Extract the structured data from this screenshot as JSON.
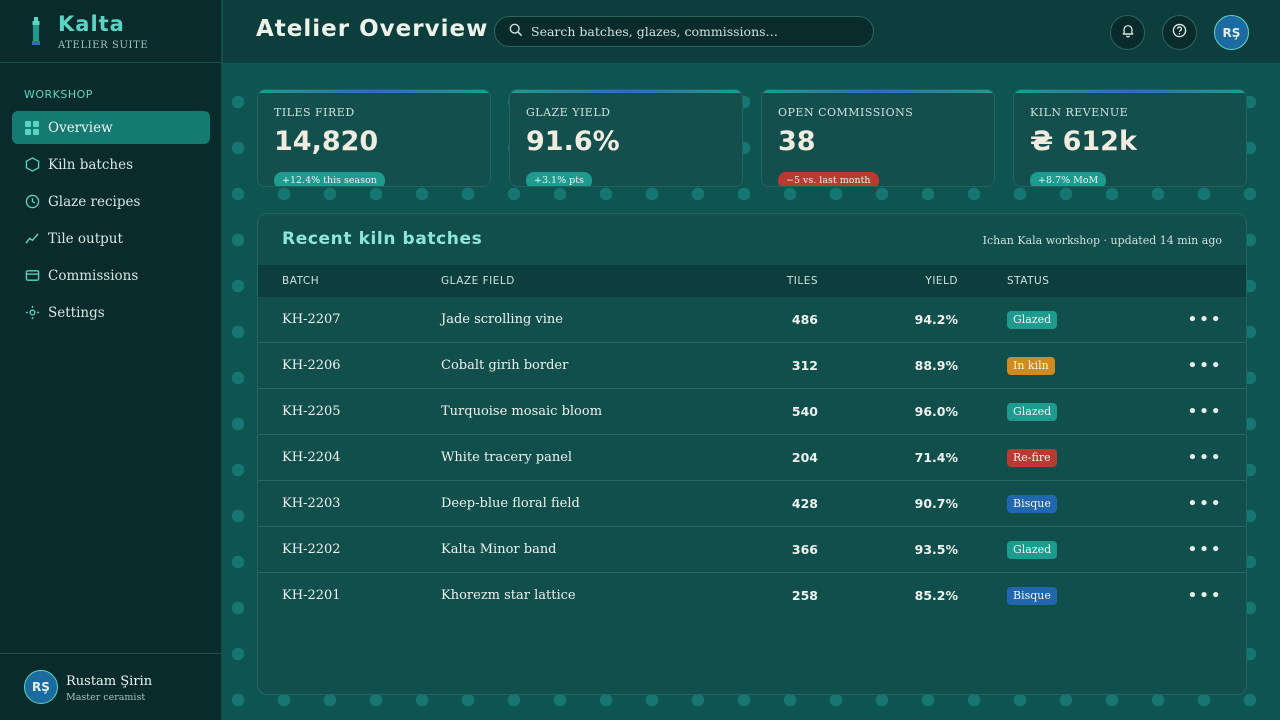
{
  "brand": {
    "name": "Kalta",
    "sub": "ATELIER SUITE"
  },
  "nav": {
    "section": "WORKSHOP",
    "items": [
      {
        "label": "Overview",
        "icon": "grid-icon"
      },
      {
        "label": "Kiln batches",
        "icon": "hexagon-icon"
      },
      {
        "label": "Glaze recipes",
        "icon": "clock-icon"
      },
      {
        "label": "Tile output",
        "icon": "chart-line-icon"
      },
      {
        "label": "Commissions",
        "icon": "card-icon"
      },
      {
        "label": "Settings",
        "icon": "gear-icon"
      }
    ]
  },
  "user": {
    "initials": "RŞ",
    "name": "Rustam Şirin",
    "role": "Master ceramist"
  },
  "header": {
    "title": "Atelier Overview",
    "search_placeholder": "Search batches, glazes, commissions…"
  },
  "kpis": [
    {
      "label": "TILES FIRED",
      "value": "14,820",
      "badge": "+12.4% this season",
      "badge_color": "#1d9b8f"
    },
    {
      "label": "GLAZE YIELD",
      "value": "91.6%",
      "badge": "+3.1% pts",
      "badge_color": "#1d9b8f"
    },
    {
      "label": "OPEN COMMISSIONS",
      "value": "38",
      "badge": "−5 vs. last month",
      "badge_color": "#b83a32"
    },
    {
      "label": "KILN REVENUE",
      "value": "₴ 612k",
      "badge": "+8.7% MoM",
      "badge_color": "#1d9b8f"
    }
  ],
  "table": {
    "title": "Recent kiln batches",
    "meta": "Ichan Kala workshop · updated 14 min ago",
    "columns": {
      "batch": "BATCH",
      "glaze": "GLAZE FIELD",
      "tiles": "TILES",
      "yield": "YIELD",
      "status": "STATUS"
    },
    "rows": [
      {
        "batch": "KH-2207",
        "glaze": "Jade scrolling vine",
        "tiles": "486",
        "yield": "94.2%",
        "status": "Glazed",
        "status_color": "#1d9b8f"
      },
      {
        "batch": "KH-2206",
        "glaze": "Cobalt girih border",
        "tiles": "312",
        "yield": "88.9%",
        "status": "In kiln",
        "status_color": "#d08a1e"
      },
      {
        "batch": "KH-2205",
        "glaze": "Turquoise mosaic bloom",
        "tiles": "540",
        "yield": "96.0%",
        "status": "Glazed",
        "status_color": "#1d9b8f"
      },
      {
        "batch": "KH-2204",
        "glaze": "White tracery panel",
        "tiles": "204",
        "yield": "71.4%",
        "status": "Re-fire",
        "status_color": "#b83a32"
      },
      {
        "batch": "KH-2203",
        "glaze": "Deep-blue floral field",
        "tiles": "428",
        "yield": "90.7%",
        "status": "Bisque",
        "status_color": "#2167b0"
      },
      {
        "batch": "KH-2202",
        "glaze": "Kalta Minor band",
        "tiles": "366",
        "yield": "93.5%",
        "status": "Glazed",
        "status_color": "#1d9b8f"
      },
      {
        "batch": "KH-2201",
        "glaze": "Khorezm star lattice",
        "tiles": "258",
        "yield": "85.2%",
        "status": "Bisque",
        "status_color": "#2167b0"
      }
    ]
  }
}
